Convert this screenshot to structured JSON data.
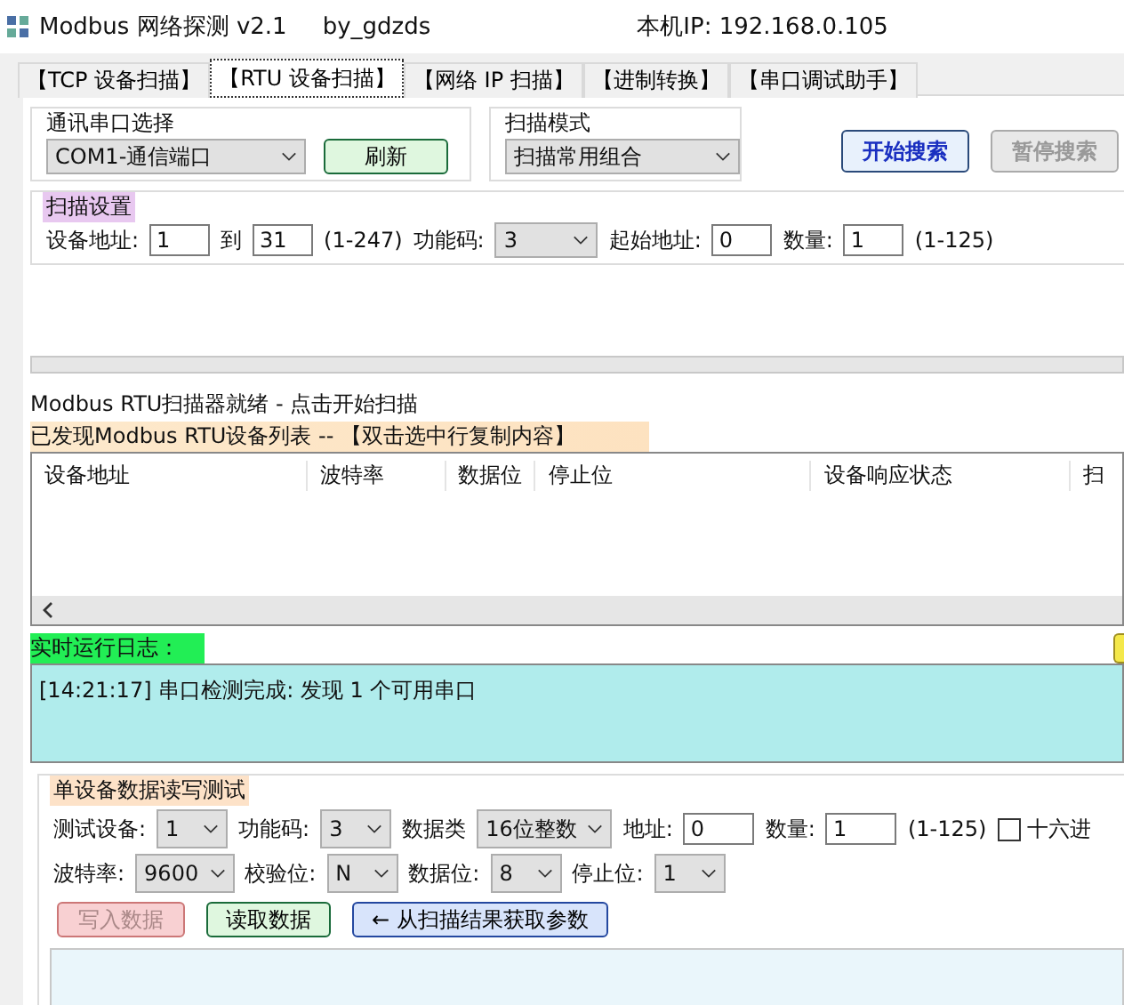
{
  "window": {
    "title": "Modbus 网络探测 v2.1",
    "author": "by_gdzds",
    "local_ip": "本机IP: 192.168.0.105"
  },
  "tabs": [
    {
      "label": "【TCP 设备扫描】",
      "selected": false
    },
    {
      "label": "【RTU 设备扫描】",
      "selected": true
    },
    {
      "label": "【网络 IP 扫描】",
      "selected": false
    },
    {
      "label": "【进制转换】",
      "selected": false
    },
    {
      "label": "【串口调试助手】",
      "selected": false
    }
  ],
  "serial_group": {
    "title": "通讯串口选择",
    "port": "COM1-通信端口",
    "refresh_button": "刷新"
  },
  "scan_mode_group": {
    "title": "扫描模式",
    "mode": "扫描常用组合"
  },
  "scan_buttons": [
    {
      "label": "开始搜索",
      "disabled": false
    },
    {
      "label": "暂停搜索",
      "disabled": true
    }
  ],
  "scan_settings": {
    "title": "扫描设置",
    "items": [
      {
        "kind": "label",
        "text": "设备地址:"
      },
      {
        "kind": "input",
        "value": "1"
      },
      {
        "kind": "label",
        "text": "到"
      },
      {
        "kind": "input",
        "value": "31"
      },
      {
        "kind": "note",
        "text": "(1-247)"
      },
      {
        "kind": "label",
        "text": "功能码:"
      },
      {
        "kind": "select",
        "value": "3"
      },
      {
        "kind": "label",
        "text": "起始地址:"
      },
      {
        "kind": "input",
        "value": "0"
      },
      {
        "kind": "label",
        "text": "数量:"
      },
      {
        "kind": "input",
        "value": "1"
      },
      {
        "kind": "note",
        "text": "(1-125)"
      }
    ]
  },
  "progress": {
    "level": 0
  },
  "status": "Modbus RTU扫描器就绪 - 点击开始扫描",
  "device_list": {
    "title": "已发现Modbus RTU设备列表 -- 【双击选中行复制内容】",
    "columns": [
      "设备地址",
      "波特率",
      "数据位",
      "停止位",
      "设备响应状态",
      "扫"
    ]
  },
  "log": {
    "title": "实时运行日志：",
    "lines": [
      "[14:21:17] 串口检测完成: 发现 1 个可用串口"
    ]
  },
  "test_group": {
    "title": "单设备数据读写测试",
    "rows": [
      [
        {
          "kind": "label",
          "text": "测试设备:"
        },
        {
          "kind": "select",
          "value": "1"
        },
        {
          "kind": "label",
          "text": "功能码:"
        },
        {
          "kind": "select",
          "value": "3"
        },
        {
          "kind": "label",
          "text": "数据类"
        },
        {
          "kind": "select",
          "value": "16位整数"
        },
        {
          "kind": "label",
          "text": "地址:"
        },
        {
          "kind": "input",
          "value": "0"
        },
        {
          "kind": "label",
          "text": "数量:"
        },
        {
          "kind": "input",
          "value": "1"
        },
        {
          "kind": "note",
          "text": "(1-125)"
        },
        {
          "kind": "checkbox",
          "text": "十六进",
          "checked": false
        }
      ],
      [
        {
          "kind": "label",
          "text": "波特率:"
        },
        {
          "kind": "select",
          "value": "9600"
        },
        {
          "kind": "label",
          "text": "校验位:"
        },
        {
          "kind": "select",
          "value": "N"
        },
        {
          "kind": "label",
          "text": "数据位:"
        },
        {
          "kind": "select",
          "value": "8"
        },
        {
          "kind": "label",
          "text": "停止位:"
        },
        {
          "kind": "select",
          "value": "1"
        }
      ]
    ],
    "buttons": [
      {
        "label": "写入数据",
        "kind": "write",
        "disabled": true
      },
      {
        "label": "读取数据",
        "kind": "read",
        "disabled": false
      },
      {
        "label": "← 从扫描结果获取参数",
        "kind": "fetch",
        "disabled": false
      }
    ]
  }
}
